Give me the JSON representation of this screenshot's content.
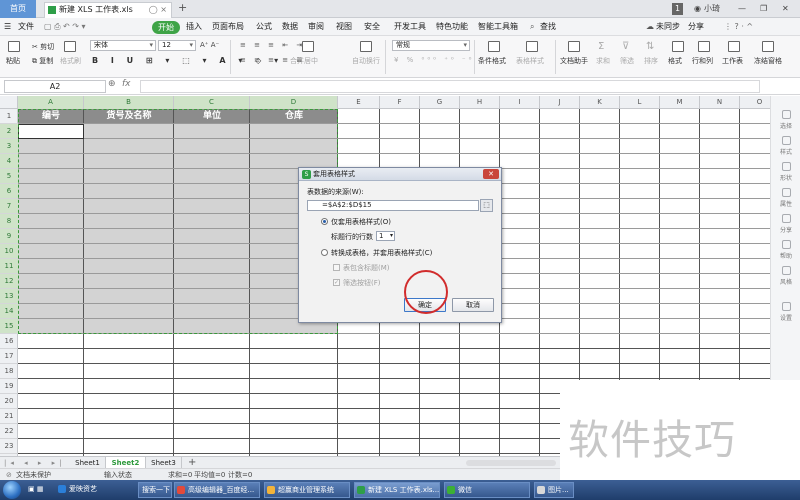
{
  "titlebar": {
    "home_tab": "首页",
    "doc_tab": "新建 XLS 工作表.xls",
    "tab_count": "1",
    "user": "小琦"
  },
  "menubar": {
    "file": "文件",
    "items": [
      "开始",
      "插入",
      "页面布局",
      "公式",
      "数据",
      "审阅",
      "视图",
      "安全",
      "开发工具",
      "特色功能",
      "智能工具箱"
    ],
    "search": "查找",
    "sync": "未同步",
    "share": "分享"
  },
  "toolbar": {
    "paste": "粘贴",
    "cut": "剪切",
    "copy": "复制",
    "format_painter": "格式刷",
    "font": "宋体",
    "size": "12",
    "merge_center": "合并居中",
    "auto_wrap": "自动换行",
    "number_format": "常规",
    "conditional_format": "条件格式",
    "table_style": "表格样式",
    "doc_helper": "文档助手",
    "sum": "求和",
    "filter": "筛选",
    "sort": "排序",
    "format": "格式",
    "row_col": "行和列",
    "worksheet": "工作表",
    "freeze": "冻结窗格"
  },
  "formulabar": {
    "cell_ref": "A2",
    "fx": "fx"
  },
  "columns": [
    "A",
    "B",
    "C",
    "D",
    "E",
    "F",
    "G",
    "H",
    "I",
    "J",
    "K",
    "L",
    "M",
    "N",
    "O"
  ],
  "rows": [
    "1",
    "2",
    "3",
    "4",
    "5",
    "6",
    "7",
    "8",
    "9",
    "10",
    "11",
    "12",
    "13",
    "14",
    "15",
    "16",
    "17",
    "18",
    "19",
    "20",
    "21",
    "22",
    "23"
  ],
  "table": {
    "headers": [
      "编号",
      "货号及名称",
      "单位",
      "仓库"
    ]
  },
  "dialog": {
    "title": "套用表格样式",
    "source_label": "表数据的来源(W):",
    "range": "=$A$2:$D$15",
    "opt1": "仅套用表格样式(O)",
    "header_rows_label": "标题行的行数",
    "header_rows_value": "1",
    "opt2": "转换成表格，并套用表格样式(C)",
    "chk1": "表包含标题(M)",
    "chk2": "筛选按钮(F)",
    "ok": "确定",
    "cancel": "取消"
  },
  "sheets": [
    "Sheet1",
    "Sheet2",
    "Sheet3"
  ],
  "active_sheet": "Sheet2",
  "status": {
    "protect": "文档未保护",
    "input_state": "输入状态",
    "sum": "求和=0",
    "avg": "平均值=0",
    "count": "计数=0"
  },
  "rightpanel": [
    "选择",
    "样式",
    "形状",
    "属性",
    "分享",
    "帮助",
    "风格",
    "设置"
  ],
  "watermark": "软件技巧",
  "taskbar": {
    "items": [
      "爱映资艺",
      "搜索一下",
      "高级编辑器_百度经...",
      "超赢商业管理系统",
      "新建 XLS 工作表.xls...",
      "微信",
      "图片..."
    ]
  }
}
